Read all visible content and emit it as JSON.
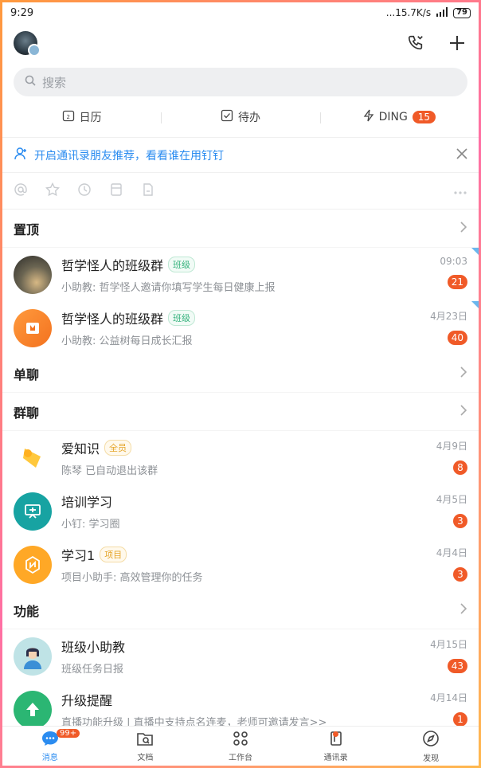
{
  "status": {
    "time": "9:29",
    "network": "...15.7K/s",
    "battery": "79"
  },
  "search": {
    "placeholder": "搜索"
  },
  "quickbar": [
    {
      "label": "日历",
      "icon": "calendar-icon"
    },
    {
      "label": "待办",
      "icon": "todo-check-icon"
    },
    {
      "label": "DING",
      "icon": "lightning-icon",
      "badge": "15"
    }
  ],
  "banner": {
    "text": "开启通讯录朋友推荐，看看谁在用钉钉"
  },
  "sections": {
    "pinned": "置顶",
    "single": "单聊",
    "group": "群聊",
    "feature": "功能"
  },
  "pinned": [
    {
      "title": "哲学怪人的班级群",
      "tag": "班级",
      "sub": "小助教: 哲学怪人邀请你填写学生每日健康上报",
      "time": "09:03",
      "count": "21"
    },
    {
      "title": "哲学怪人的班级群",
      "tag": "班级",
      "sub": "小助教: 公益树每日成长汇报",
      "time": "4月23日",
      "count": "40"
    }
  ],
  "groups": [
    {
      "title": "爱知识",
      "tag": "全员",
      "sub": "陈琴 已自动退出该群",
      "time": "4月9日",
      "count": "8"
    },
    {
      "title": "培训学习",
      "tag": "",
      "sub": "小钉: 学习圈",
      "time": "4月5日",
      "count": "3"
    },
    {
      "title": "学习1",
      "tag": "项目",
      "sub": "项目小助手: 高效管理你的任务",
      "time": "4月4日",
      "count": "3"
    }
  ],
  "features": [
    {
      "title": "班级小助教",
      "sub": "班级任务日报",
      "time": "4月15日",
      "count": "43"
    },
    {
      "title": "升级提醒",
      "sub": "直播功能升级 | 直播中支持点名连麦，老师可邀请发言>>",
      "time": "4月14日",
      "count": "1"
    }
  ],
  "nav": [
    {
      "label": "消息",
      "badge": "99+"
    },
    {
      "label": "文档"
    },
    {
      "label": "工作台"
    },
    {
      "label": "通讯录"
    },
    {
      "label": "发现"
    }
  ],
  "colors": {
    "accent": "#2b8cf0",
    "badge": "#f05a28",
    "tag_green": "#37b37e"
  }
}
